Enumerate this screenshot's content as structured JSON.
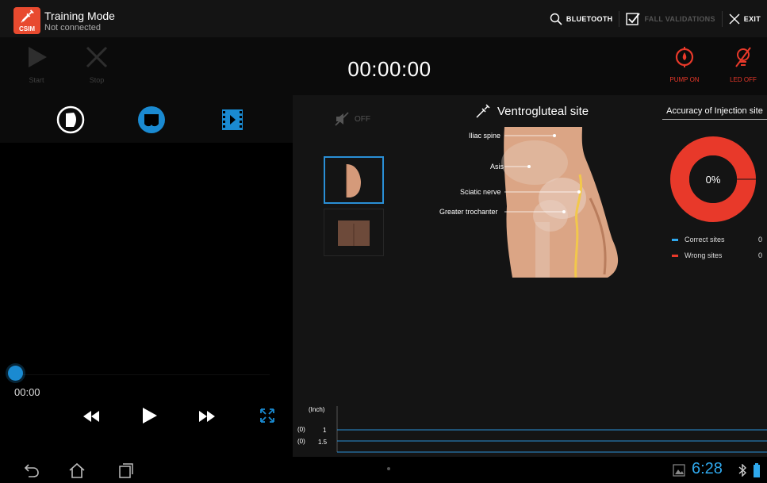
{
  "titlebar": {
    "logo_text": "CSIM",
    "title": "Training Mode",
    "subtitle": "Not connected",
    "bluetooth_label": "BLUETOOTH",
    "validate_label": "FALL VALIDATIONS",
    "exit_label": "EXIT"
  },
  "controls": {
    "start_label": "Start",
    "stop_label": "Stop",
    "timer": "00:00:00",
    "pump_label": "PUMP ON",
    "led_label": "LED OFF"
  },
  "player": {
    "time": "00:00",
    "progress": 0
  },
  "site": {
    "sound_label": "OFF",
    "title": "Ventrogluteal site",
    "labels": [
      "Iliac spine",
      "Asis",
      "Sciatic nerve",
      "Greater trochanter"
    ]
  },
  "accuracy": {
    "title": "Accuracy of Injection site",
    "percent_label": "0%",
    "legend": [
      {
        "label": "Correct sites",
        "value": "0",
        "color": "#2fa9ee"
      },
      {
        "label": "Wrong sites",
        "value": "0",
        "color": "#e8392a"
      }
    ]
  },
  "depth": {
    "unit": "(Inch)",
    "rows": [
      {
        "count": "(0)",
        "depth": "1"
      },
      {
        "count": "(0)",
        "depth": "1.5"
      }
    ]
  },
  "navbar": {
    "clock": "6:28"
  },
  "colors": {
    "accent_blue": "#2a8fd6",
    "alert_red": "#e8392a",
    "skin": "#dba585"
  }
}
